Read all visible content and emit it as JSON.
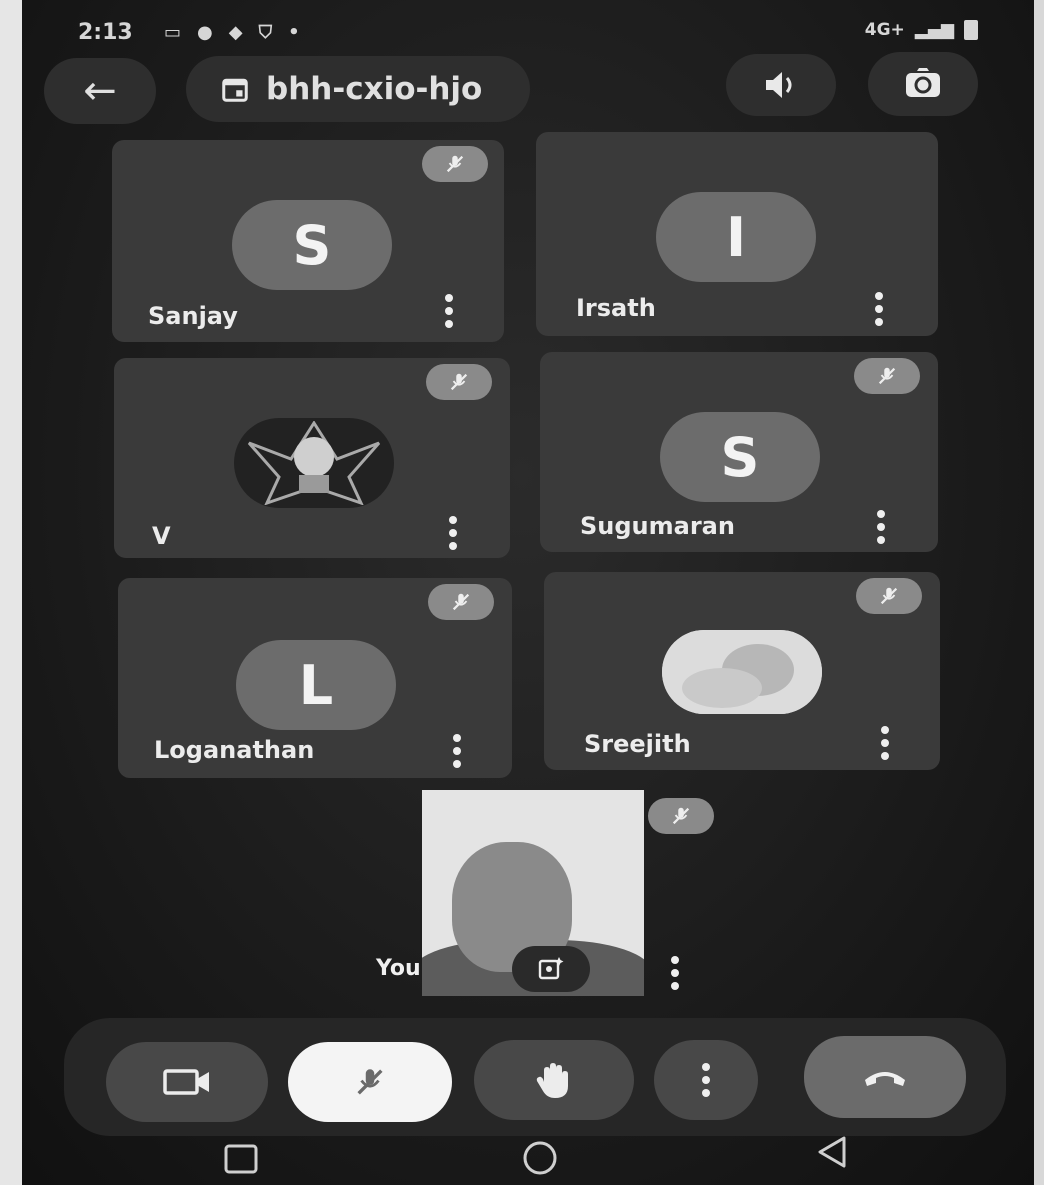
{
  "status_bar": {
    "time": "2:13",
    "network": "4G+",
    "signal": "all",
    "icons": [
      "cast-icon",
      "chat-icon",
      "vpn-icon",
      "shield-icon",
      "dot-icon"
    ]
  },
  "header": {
    "meeting_code": "bhh-cxio-hjo"
  },
  "participants": [
    {
      "name": "Sanjay",
      "initial": "S",
      "avatar": "letter"
    },
    {
      "name": "Irsath",
      "initial": "I",
      "avatar": "letter"
    },
    {
      "name": "V",
      "initial": "",
      "avatar": "image"
    },
    {
      "name": "Sugumaran",
      "initial": "S",
      "avatar": "letter"
    },
    {
      "name": "Loganathan",
      "initial": "L",
      "avatar": "letter"
    },
    {
      "name": "Sreejith",
      "initial": "",
      "avatar": "image"
    }
  ],
  "self_view": {
    "label": "You"
  },
  "colors": {
    "background": "#1c1c1c",
    "tile": "#3a3a3a",
    "avatar": "#6c6c6c",
    "mic_button": "#f4f4f4",
    "end_call": "#6b6b6b"
  }
}
